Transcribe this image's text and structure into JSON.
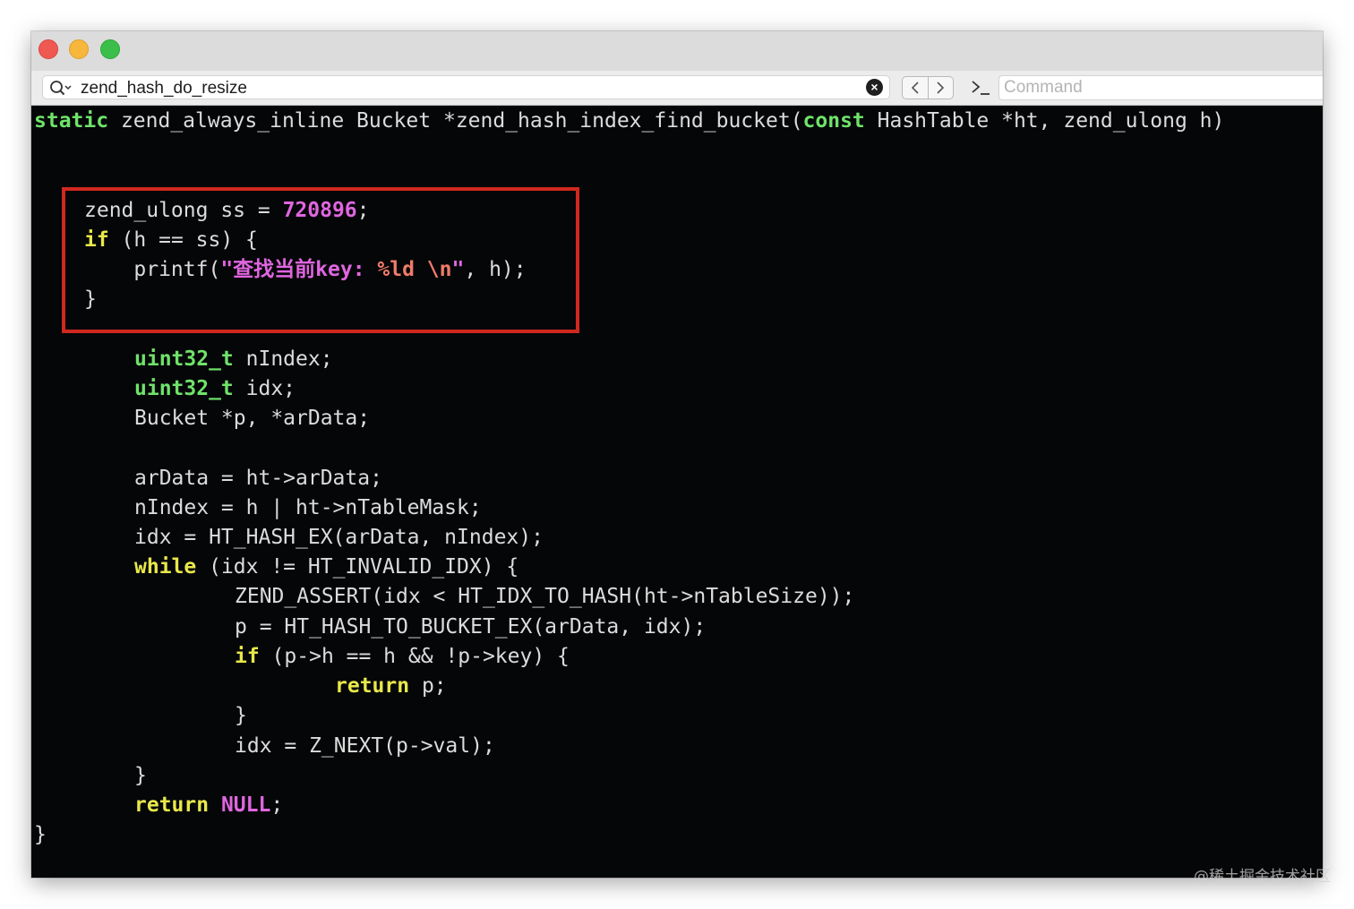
{
  "toolbar": {
    "search_value": "zend_hash_do_resize",
    "command_placeholder": "Command",
    "icons": [
      "search-icon",
      "clear-icon",
      "back-icon",
      "forward-icon",
      "terminal-icon"
    ]
  },
  "code": {
    "signature": {
      "kw_static": "static",
      "rest1": " zend_always_inline Bucket *zend_hash_index_find_bucket(",
      "kw_const": "const",
      "rest2": " HashTable *ht, zend_ulong h)"
    },
    "l1": {
      "pre": "zend_ulong ss = ",
      "num": "720896",
      "post": ";"
    },
    "l2": {
      "kw": "if",
      "post": " (h == ss) {"
    },
    "l3": {
      "pre": "    printf(",
      "s1": "\"查找当前key: ",
      "ph": "%ld \\n",
      "s2": "\"",
      "post": ", h);"
    },
    "l4": {
      "text": "}"
    },
    "l5": {
      "type": "uint32_t",
      "post": " nIndex;"
    },
    "l6": {
      "type": "uint32_t",
      "post": " idx;"
    },
    "l7": {
      "text": "Bucket *p, *arData;"
    },
    "l8": {
      "text": "arData = ht->arData;"
    },
    "l9": {
      "text": "nIndex = h | ht->nTableMask;"
    },
    "l10": {
      "text": "idx = HT_HASH_EX(arData, nIndex);"
    },
    "l11": {
      "kw": "while",
      "post": " (idx != HT_INVALID_IDX) {"
    },
    "l12": {
      "text": "ZEND_ASSERT(idx < HT_IDX_TO_HASH(ht->nTableSize));"
    },
    "l13": {
      "text": "p = HT_HASH_TO_BUCKET_EX(arData, idx);"
    },
    "l14": {
      "kw": "if",
      "post": " (p->h == h && !p->key) {"
    },
    "l15": {
      "kw": "return",
      "post": " p;"
    },
    "l16": {
      "text": "}"
    },
    "l17": {
      "text": "idx = Z_NEXT(p->val);"
    },
    "l18": {
      "text": "}"
    },
    "l19": {
      "kw": "return",
      "nul": "NULL",
      "post": ";"
    },
    "l20": {
      "text": "}"
    }
  },
  "watermark": "@稀土掘金技术社区",
  "colors": {
    "background": "#050608",
    "keyword": "#e8e84a",
    "type": "#6fe36a",
    "literal": "#e066e0",
    "highlight_border": "#d0281f"
  }
}
